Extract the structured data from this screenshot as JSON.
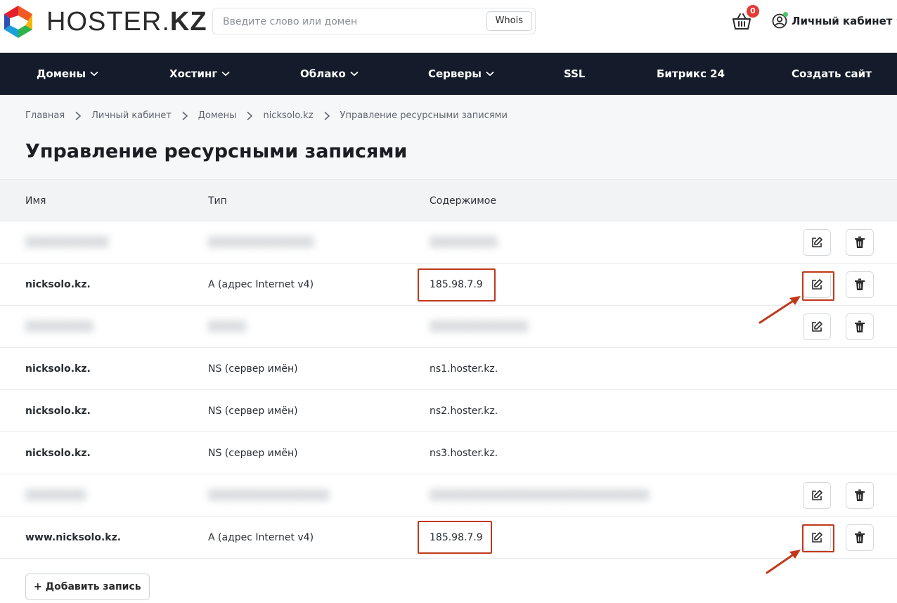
{
  "brand": {
    "logo_text_light": "HOSTER.",
    "logo_text_bold": "KZ"
  },
  "search": {
    "placeholder": "Введите слово или домен",
    "button_label": "Whois"
  },
  "cart": {
    "count": "0"
  },
  "account": {
    "label": "Личный кабинет"
  },
  "nav": {
    "items": [
      {
        "label": "Домены",
        "dropdown": true
      },
      {
        "label": "Хостинг",
        "dropdown": true
      },
      {
        "label": "Облако",
        "dropdown": true
      },
      {
        "label": "Серверы",
        "dropdown": true
      },
      {
        "label": "SSL",
        "dropdown": false
      },
      {
        "label": "Битрикс 24",
        "dropdown": false
      },
      {
        "label": "Создать сайт",
        "dropdown": false
      }
    ]
  },
  "breadcrumb": [
    "Главная",
    "Личный кабинет",
    "Домены",
    "nicksolo.kz",
    "Управление ресурсными записями"
  ],
  "page": {
    "title": "Управление ресурсными записями"
  },
  "table": {
    "headers": {
      "name": "Имя",
      "type": "Тип",
      "content": "Содержимое"
    },
    "rows": [
      {
        "name": "nicksolo.kz.",
        "type": "A (адрес Internet v4)",
        "content": "185.98.7.9"
      },
      {
        "name": "nicksolo.kz.",
        "type": "NS (сервер имён)",
        "content": "ns1.hoster.kz."
      },
      {
        "name": "nicksolo.kz.",
        "type": "NS (сервер имён)",
        "content": "ns2.hoster.kz."
      },
      {
        "name": "nicksolo.kz.",
        "type": "NS (сервер имён)",
        "content": "ns3.hoster.kz."
      },
      {
        "name": "www.nicksolo.kz.",
        "type": "A (адрес Internet v4)",
        "content": "185.98.7.9"
      }
    ]
  },
  "add_button": {
    "label": "+ Добавить запись"
  },
  "colors": {
    "nav_bg": "#141c2b",
    "highlight": "#c0391b",
    "badge": "#e53935"
  }
}
